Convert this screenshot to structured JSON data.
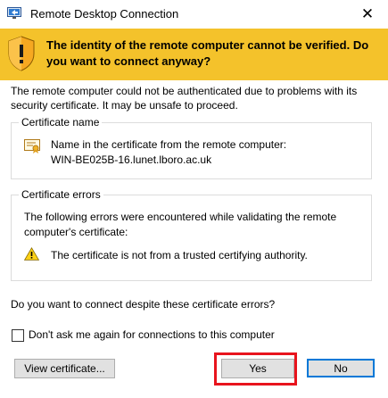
{
  "window": {
    "title": "Remote Desktop Connection",
    "close_glyph": "✕",
    "icon": "remote-desktop-icon"
  },
  "banner": {
    "text": "The identity of the remote computer cannot be verified. Do you want to connect anyway?",
    "icon": "shield-warning-icon",
    "background": "#f4c22b"
  },
  "intro": "The remote computer could not be authenticated due to problems with its security certificate. It may be unsafe to proceed.",
  "certificate": {
    "heading": "Certificate name",
    "line1": "Name in the certificate from the remote computer:",
    "line2": "WIN-BE025B-16.lunet.lboro.ac.uk",
    "icon": "certificate-icon"
  },
  "errors": {
    "heading": "Certificate errors",
    "description": "The following errors were encountered while validating the remote computer's certificate:",
    "item": "The certificate is not from a trusted certifying authority.",
    "icon": "warning-icon"
  },
  "question": "Do you want to connect despite these certificate errors?",
  "dont_ask": {
    "label": "Don't ask me again for connections to this computer",
    "checked": false
  },
  "buttons": {
    "view": "View certificate...",
    "yes": "Yes",
    "no": "No"
  },
  "colors": {
    "highlight": "#e8141d",
    "default_button_border": "#0078d7"
  }
}
